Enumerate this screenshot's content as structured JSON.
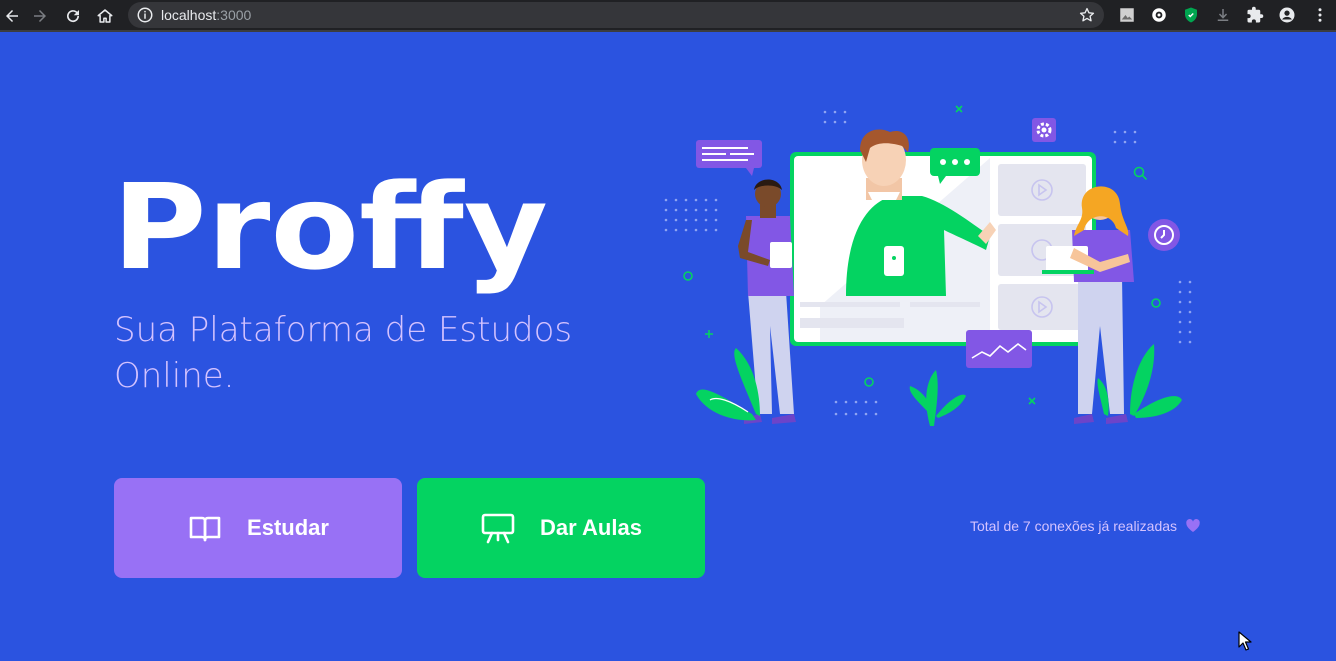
{
  "browser": {
    "url_host": "localhost",
    "url_port": ":3000",
    "icons": [
      "back-icon",
      "forward-icon",
      "reload-icon",
      "home-icon",
      "info-icon",
      "star-icon",
      "image-extension-icon",
      "github-extension-icon",
      "shield-extension-icon",
      "download-icon",
      "extensions-puzzle-icon",
      "profile-avatar-icon",
      "kebab-menu-icon"
    ]
  },
  "hero": {
    "logo_text": "Proffy",
    "tagline": "Sua Plataforma de Estudos Online."
  },
  "buttons": {
    "study_label": "Estudar",
    "teach_label": "Dar Aulas"
  },
  "footer": {
    "connections_text": "Total de 7 conexões já realizadas"
  },
  "colors": {
    "background": "#2b53e0",
    "study_button": "#9871f5",
    "teach_button": "#04d361",
    "tagline": "#d4c2ff",
    "heart": "#9871f5"
  }
}
